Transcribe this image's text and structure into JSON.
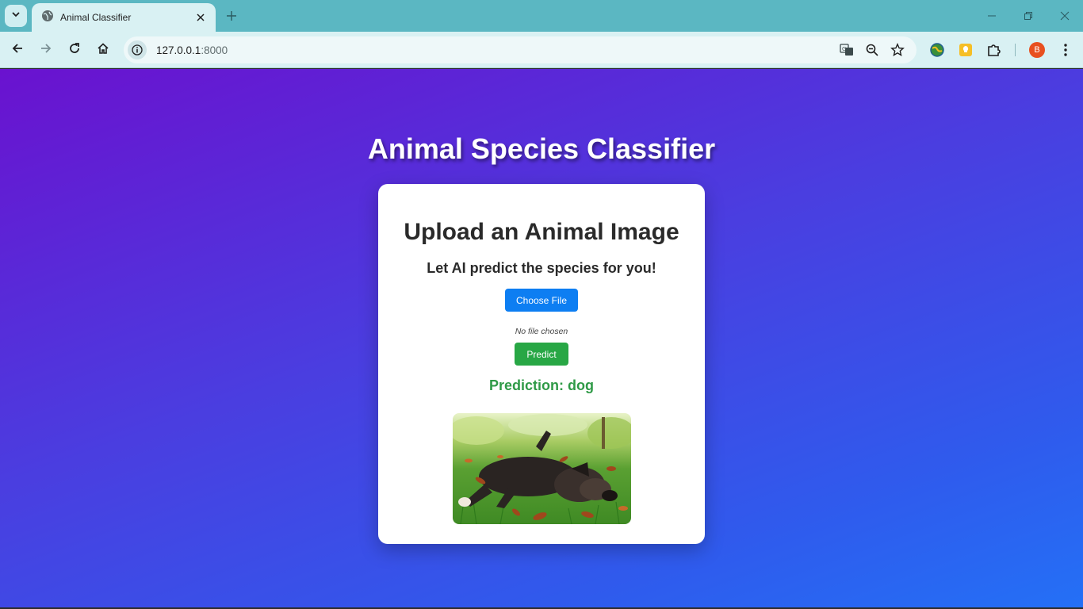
{
  "browser": {
    "tab_title": "Animal Classifier",
    "url_host": "127.0.0.1",
    "url_port": ":8000",
    "profile_initial": "B"
  },
  "page": {
    "title": "Animal Species Classifier",
    "card": {
      "heading": "Upload an Animal Image",
      "subheading": "Let AI predict the species for you!",
      "choose_file_label": "Choose File",
      "file_status": "No file chosen",
      "predict_label": "Predict",
      "prediction_label": "Prediction:",
      "prediction_value": "dog"
    }
  },
  "colors": {
    "choose_button": "#0d7ef2",
    "predict_button": "#28a745",
    "prediction_text": "#2f9a47",
    "browser_frame": "#5bb7c2"
  },
  "icons": {
    "tab_search": "chevron-down-icon",
    "tab_favicon": "globe-icon",
    "back": "arrow-left-icon",
    "forward": "arrow-right-icon",
    "reload": "reload-icon",
    "home": "home-icon",
    "site_info": "info-icon",
    "translate": "translate-icon",
    "zoom": "zoom-out-icon",
    "bookmark": "star-icon",
    "extensions": "puzzle-icon",
    "menu": "kebab-menu-icon"
  }
}
